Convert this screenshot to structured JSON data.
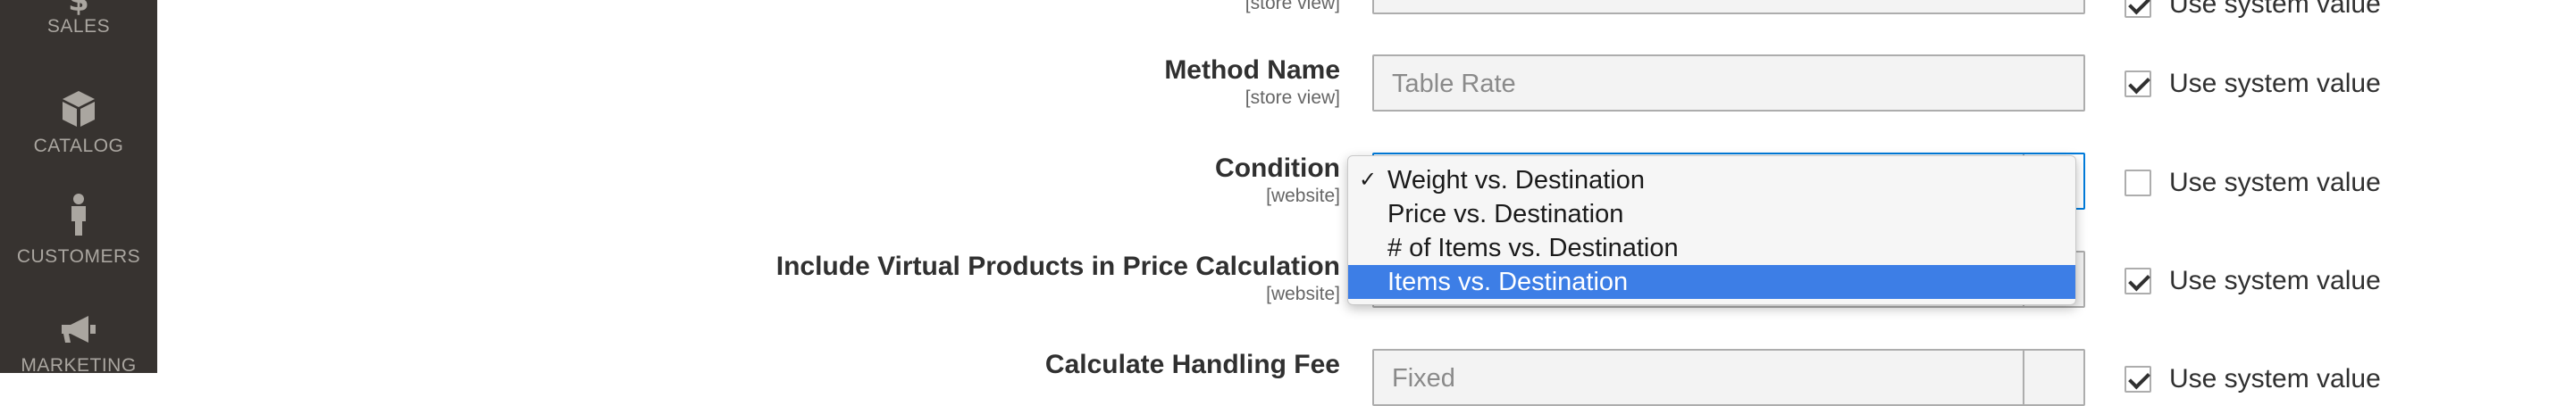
{
  "sidebar": {
    "items": [
      {
        "label": "SALES",
        "icon": "dollar-icon"
      },
      {
        "label": "CATALOG",
        "icon": "box-icon"
      },
      {
        "label": "CUSTOMERS",
        "icon": "person-icon"
      },
      {
        "label": "MARKETING",
        "icon": "megaphone-icon"
      }
    ]
  },
  "rows": {
    "top": {
      "scope": "[store view]",
      "use_system": "Use system value"
    },
    "method_name": {
      "label": "Method Name",
      "scope": "[store view]",
      "value": "Table Rate",
      "use_system": "Use system value",
      "use_system_checked": true
    },
    "condition": {
      "label": "Condition",
      "scope": "[website]",
      "use_system": "Use system value",
      "use_system_checked": false
    },
    "virtual": {
      "label": "Include Virtual Products in Price Calculation",
      "scope": "[website]",
      "use_system": "Use system value",
      "use_system_checked": true
    },
    "handling": {
      "label": "Calculate Handling Fee",
      "value": "Fixed",
      "use_system": "Use system value"
    }
  },
  "condition_dropdown": {
    "check_mark": "✓",
    "options": [
      {
        "label": "Weight vs. Destination",
        "checked": true,
        "highlighted": false
      },
      {
        "label": "Price vs. Destination",
        "checked": false,
        "highlighted": false
      },
      {
        "label": "# of Items vs. Destination",
        "checked": false,
        "highlighted": false
      },
      {
        "label": "Items vs. Destination",
        "checked": false,
        "highlighted": true
      }
    ]
  },
  "colors": {
    "sidebar_bg": "#373330",
    "highlight": "#3d7ee6",
    "focus_border": "#007bdb"
  }
}
